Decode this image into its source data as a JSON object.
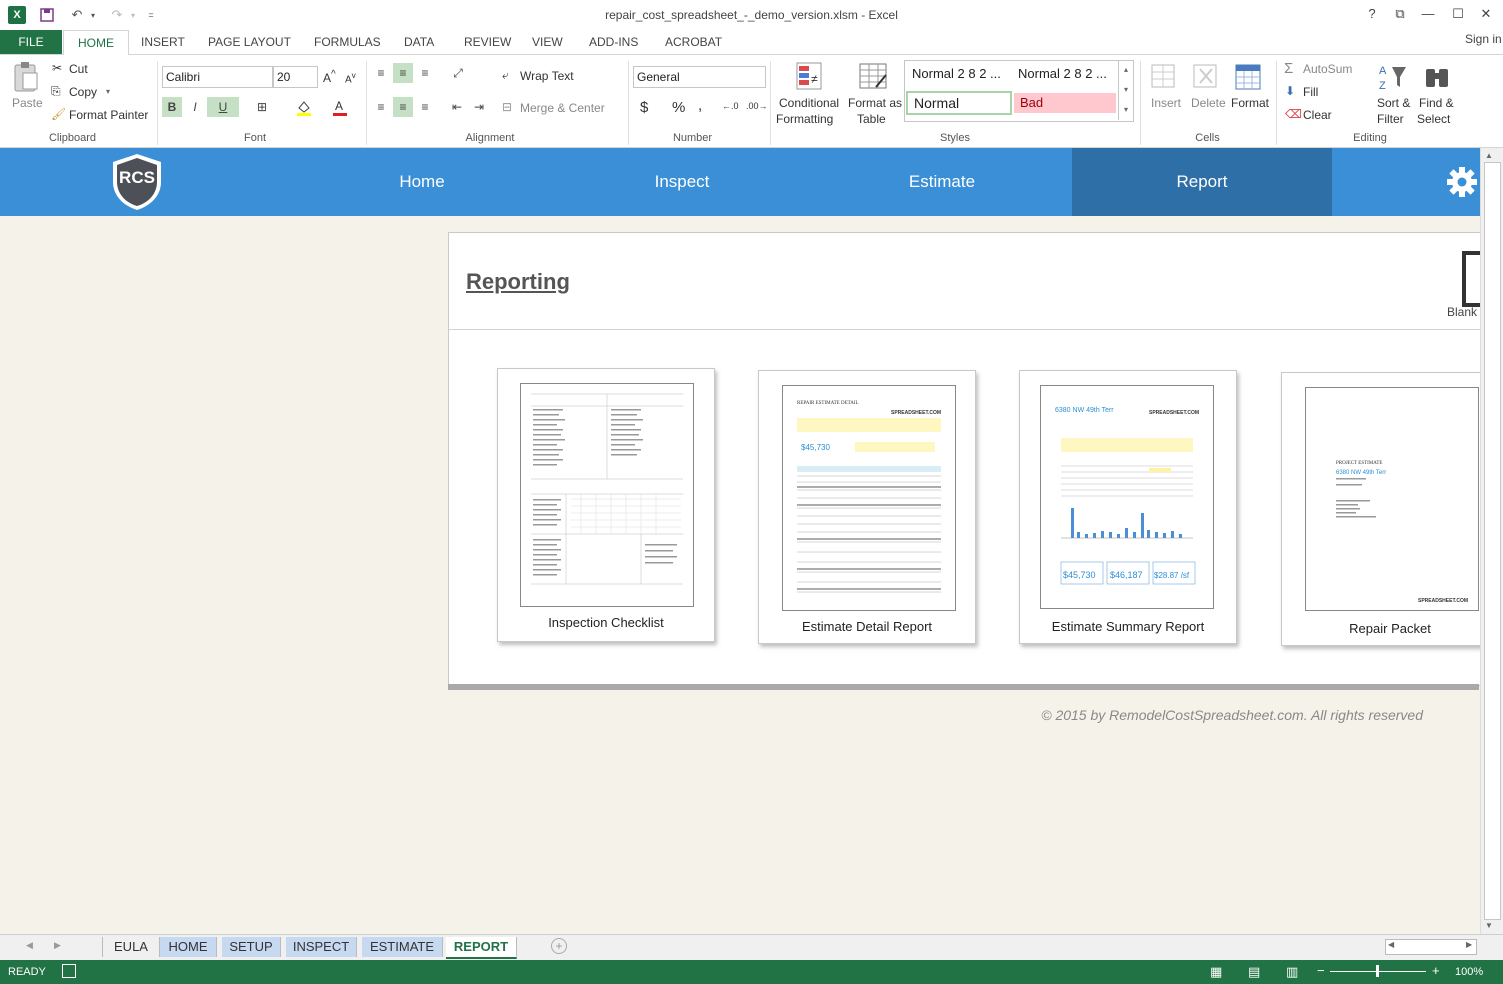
{
  "window": {
    "title": "repair_cost_spreadsheet_-_demo_version.xlsm - Excel",
    "help": "?",
    "sign_in": "Sign in"
  },
  "ribbon_tabs": [
    "FILE",
    "HOME",
    "INSERT",
    "PAGE LAYOUT",
    "FORMULAS",
    "DATA",
    "REVIEW",
    "VIEW",
    "ADD-INS",
    "ACROBAT"
  ],
  "clipboard": {
    "paste": "Paste",
    "cut": "Cut",
    "copy": "Copy",
    "format_painter": "Format Painter",
    "label": "Clipboard"
  },
  "font": {
    "name": "Calibri",
    "size": "20",
    "bold": "B",
    "italic": "I",
    "underline": "U",
    "label": "Font"
  },
  "alignment": {
    "wrap_text": "Wrap Text",
    "merge_center": "Merge & Center",
    "label": "Alignment"
  },
  "number": {
    "format": "General",
    "currency": "$",
    "percent": "%",
    "comma": ",",
    "label": "Number"
  },
  "styles": {
    "conditional": "Conditional",
    "formatting": "Formatting",
    "format_as": "Format as",
    "table": "Table",
    "normal1": "Normal 2 8 2 ...",
    "normal2": "Normal 2 8 2 ...",
    "normal": "Normal",
    "bad": "Bad",
    "label": "Styles"
  },
  "cells": {
    "insert": "Insert",
    "delete": "Delete",
    "format": "Format",
    "label": "Cells"
  },
  "editing": {
    "autosum": "AutoSum",
    "fill": "Fill",
    "clear": "Clear",
    "sort": "Sort &",
    "filter": "Filter",
    "find": "Find &",
    "select": "Select",
    "label": "Editing"
  },
  "app_nav": {
    "logo": "RCS",
    "items": [
      "Home",
      "Inspect",
      "Estimate",
      "Report"
    ],
    "selected": "Report",
    "brand_color": "#3a8fd6"
  },
  "report_panel": {
    "heading": "Reporting",
    "blank_label": "Blank",
    "cards": [
      {
        "label": "Inspection Checklist"
      },
      {
        "label": "Estimate Detail Report",
        "thumb_title": "REPAIR ESTIMATE DETAIL",
        "thumb_value": "$45,730",
        "thumb_brand": "SPREADSHEET.COM"
      },
      {
        "label": "Estimate Summary Report",
        "thumb_title": "6380 NW 49th Terr",
        "thumb_values": [
          "$45,730",
          "$46,187",
          "$28.87 /sf"
        ],
        "thumb_brand": "SPREADSHEET.COM"
      },
      {
        "label": "Repair Packet",
        "thumb_title": "PROJECT ESTIMATE",
        "thumb_subtitle": "6380 NW 49th Terr",
        "thumb_brand": "SPREADSHEET.COM"
      }
    ],
    "footer": "© 2015 by RemodelCostSpreadsheet.com. All rights reserved"
  },
  "sheet_tabs": [
    "EULA",
    "HOME",
    "SETUP",
    "INSPECT",
    "ESTIMATE",
    "REPORT"
  ],
  "active_sheet": "REPORT",
  "status": {
    "ready": "READY",
    "zoom": "100%"
  }
}
